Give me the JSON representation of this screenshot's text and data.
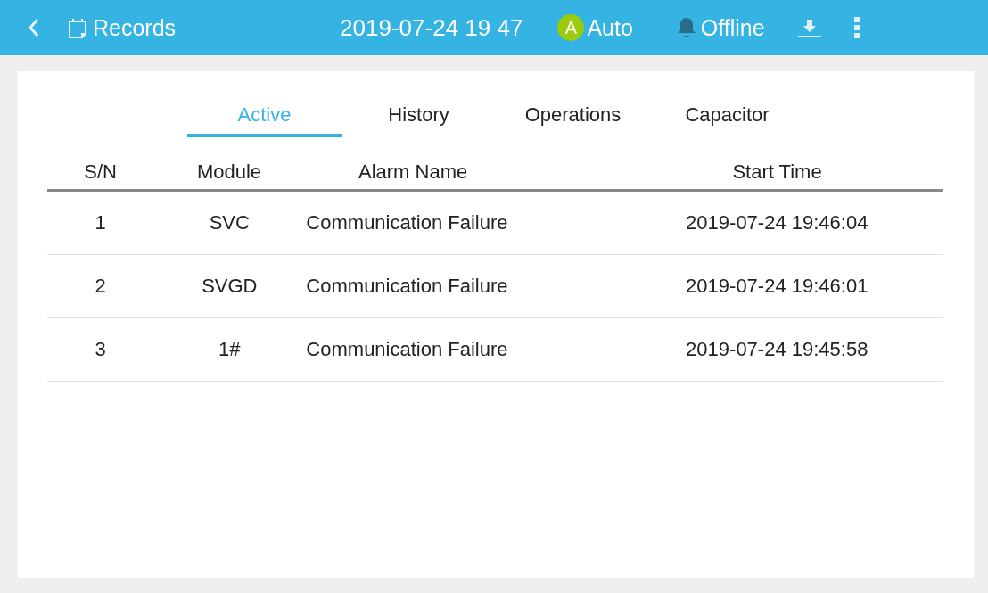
{
  "top_bar": {
    "title": "Records",
    "datetime": "2019-07-24 19 47",
    "mode_badge": "A",
    "mode": "Auto",
    "status": "Offline"
  },
  "tabs": [
    {
      "label": "Active",
      "selected": true
    },
    {
      "label": "History",
      "selected": false
    },
    {
      "label": "Operations",
      "selected": false
    },
    {
      "label": "Capacitor",
      "selected": false
    }
  ],
  "table": {
    "columns": [
      "S/N",
      "Module",
      "Alarm Name",
      "Start Time"
    ],
    "rows": [
      [
        "1",
        "SVC",
        "Communication Failure",
        "2019-07-24 19:46:04"
      ],
      [
        "2",
        "SVGD",
        "Communication Failure",
        "2019-07-24 19:46:01"
      ],
      [
        "3",
        "1#",
        "Communication Failure",
        "2019-07-24 19:45:58"
      ]
    ]
  }
}
